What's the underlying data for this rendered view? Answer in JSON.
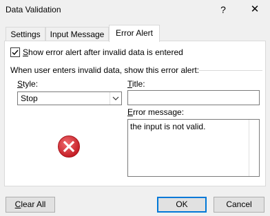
{
  "window": {
    "title": "Data Validation",
    "help_glyph": "?",
    "close_glyph": "✕"
  },
  "tabs": [
    {
      "label": "Settings"
    },
    {
      "label": "Input Message"
    },
    {
      "label": "Error Alert",
      "selected": true
    }
  ],
  "error_alert": {
    "show_alert_checkbox": {
      "label_first": "S",
      "label_rest": "how error alert after invalid data is entered",
      "checked": true
    },
    "group_label": "When user enters invalid data, show this error alert:",
    "style": {
      "label_first": "S",
      "label_rest": "tyle:",
      "value": "Stop"
    },
    "title": {
      "label_first": "T",
      "label_rest": "itle:",
      "value": ""
    },
    "error_message": {
      "label_first": "E",
      "label_rest": "rror message:",
      "value": "the input is not valid."
    },
    "icon": "stop-icon",
    "icon_color": "#d7262e"
  },
  "buttons": {
    "clear_all_first": "C",
    "clear_all_rest": "lear All",
    "ok": "OK",
    "cancel": "Cancel"
  },
  "colors": {
    "accent": "#0078d7"
  }
}
